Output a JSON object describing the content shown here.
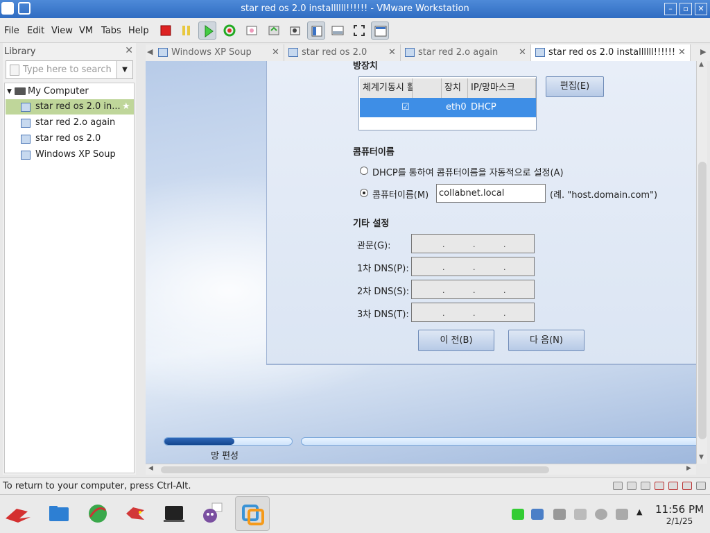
{
  "window": {
    "title": "star red os 2.0 installllll!!!!!! - VMware Workstation"
  },
  "menu": [
    "File",
    "Edit",
    "View",
    "VM",
    "Tabs",
    "Help"
  ],
  "library": {
    "title": "Library",
    "search_placeholder": "Type here to search",
    "root": "My Computer",
    "items": [
      "star red os 2.0 in...",
      "star red 2.o again",
      "star red os 2.0",
      "Windows XP Soup"
    ]
  },
  "tabs": [
    "Windows XP Soup",
    "star red os 2.0",
    "star red 2.o again",
    "star red os 2.0 installllll!!!!!!"
  ],
  "installer": {
    "device_section_title": "방장치",
    "table_headers": [
      "체계기동시 활성화",
      "장치",
      "IP/망마스크"
    ],
    "table_row": {
      "check": "☑",
      "device": "eth0",
      "ip": "DHCP"
    },
    "edit_button": "편집(E)",
    "hostname_title": "콤퓨터이름",
    "radio_dhcp": "DHCP를 통하여 콤퓨터이름을 자동적으로 설정(A)",
    "radio_manual": "콤퓨터이름(M)",
    "hostname_value": "collabnet.local",
    "hostname_example": "(례. \"host.domain.com\")",
    "other_title": "기타 설정",
    "gateway_label": "관문(G):",
    "dns1_label": "1차 DNS(P):",
    "dns2_label": "2차 DNS(S):",
    "dns3_label": "3차 DNS(T):",
    "back_button": "이 전(B)",
    "next_button": "다 음(N)",
    "progress_label": "망 편성"
  },
  "statusbar": {
    "text": "To return to your computer, press Ctrl-Alt."
  },
  "taskbar": {
    "time": "11:56 PM",
    "date": "2/1/25"
  }
}
